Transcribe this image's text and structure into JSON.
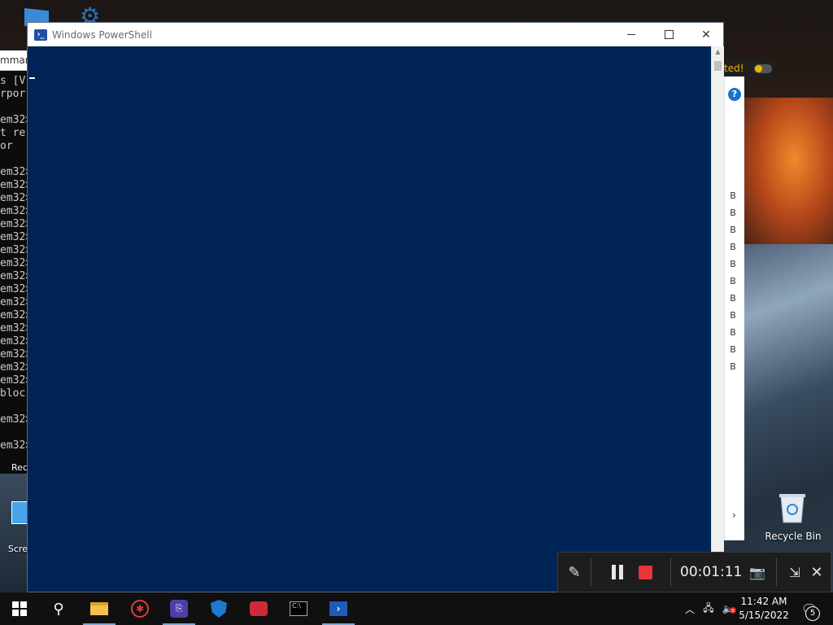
{
  "powershell": {
    "title": "Windows PowerShell",
    "controls": {
      "minimize": "minimize",
      "maximize": "maximize",
      "close": "close"
    }
  },
  "background_cmd": {
    "title_fragment": "mman",
    "lines": [
      "s [V",
      "rpor",
      "",
      "em32>",
      "t re",
      "or",
      "",
      "em32>",
      "em32>",
      "em32>",
      "em32>",
      "em32>",
      "em32>",
      "em32>",
      "em32>",
      "em32>",
      "em32>",
      "em32>",
      "em32>",
      "em32>",
      "em32>",
      "em32>",
      "em32>",
      "em32>",
      "bloc",
      "",
      "em32>",
      "",
      "em32>"
    ]
  },
  "background_explorer": {
    "notification_fragment": "ted!",
    "help": "?",
    "size_suffix": "B",
    "size_rows": 11
  },
  "desktop": {
    "recycle_bin_label": "Recycle Bin",
    "left_label_1": "Rec",
    "left_label_2": "Scre",
    "left_label_small": "i"
  },
  "recorder": {
    "elapsed": "00:01:11",
    "icons": [
      "pen-icon",
      "pause-icon",
      "stop-icon",
      "camera-icon",
      "export-icon",
      "close-icon"
    ]
  },
  "taskbar": {
    "clock_time": "11:42 AM",
    "clock_date": "5/15/2022",
    "notification_count": "5",
    "colors": {
      "background": "#101010",
      "accent": "#7aa7d8"
    }
  },
  "colors": {
    "powershell_background": "#012456",
    "record_stop": "#e8343b"
  }
}
